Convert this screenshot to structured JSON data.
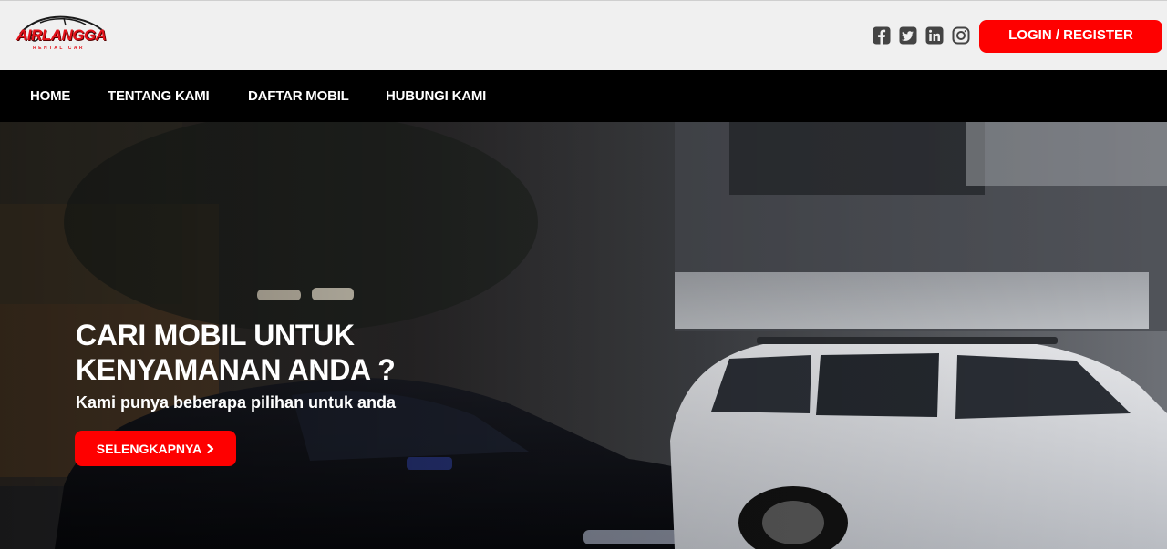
{
  "brand": {
    "name": "AIRLANGGA",
    "tagline": "RENTAL CAR"
  },
  "header": {
    "socials": [
      {
        "icon": "facebook-icon"
      },
      {
        "icon": "twitter-icon"
      },
      {
        "icon": "linkedin-icon"
      },
      {
        "icon": "instagram-icon"
      }
    ],
    "login_label": "LOGIN / REGISTER"
  },
  "nav": {
    "items": [
      {
        "label": "HOME"
      },
      {
        "label": "TENTANG KAMI"
      },
      {
        "label": "DAFTAR MOBIL"
      },
      {
        "label": "HUBUNGI KAMI"
      }
    ]
  },
  "hero": {
    "title_line1": "CARI MOBIL UNTUK",
    "title_line2": "KENYAMANAN ANDA ?",
    "subtitle": "Kami punya beberapa pilihan untuk anda",
    "cta_label": "SELENGKAPNYA",
    "cta_icon": "chevron-right-icon"
  },
  "colors": {
    "accent": "#fe0000",
    "nav_bg": "#000000",
    "topbar_bg": "#f0f0f0"
  }
}
